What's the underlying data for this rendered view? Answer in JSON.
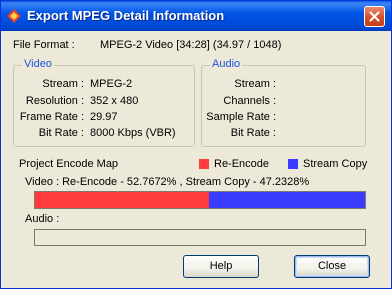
{
  "window": {
    "title": "Export MPEG Detail Information"
  },
  "file_format": {
    "label": "File Format :",
    "value": "MPEG-2 Video  [34:28] (34.97 / 1048)"
  },
  "video": {
    "legend": "Video",
    "rows": [
      {
        "label": "Stream :",
        "value": "MPEG-2"
      },
      {
        "label": "Resolution :",
        "value": "352 x 480"
      },
      {
        "label": "Frame Rate :",
        "value": "29.97"
      },
      {
        "label": "Bit Rate :",
        "value": "8000 Kbps (VBR)"
      }
    ]
  },
  "audio": {
    "legend": "Audio",
    "rows": [
      {
        "label": "Stream :",
        "value": ""
      },
      {
        "label": "Channels :",
        "value": ""
      },
      {
        "label": "Sample Rate :",
        "value": ""
      },
      {
        "label": "Bit Rate :",
        "value": ""
      }
    ]
  },
  "encode_map": {
    "title": "Project Encode Map",
    "legend_reencode": "Re-Encode",
    "legend_streamcopy": "Stream Copy",
    "video_summary": "Video : Re-Encode - 52.7672% ,  Stream Copy - 47.2328%",
    "reencode_fraction": 0.527672,
    "reencode_color": "#ff3b3b",
    "streamcopy_color": "#3b3bff",
    "audio_label": "Audio :"
  },
  "buttons": {
    "help": "Help",
    "close": "Close"
  },
  "colors": {
    "titlebar": "#0055e5",
    "legend_text": "#2050d8"
  }
}
